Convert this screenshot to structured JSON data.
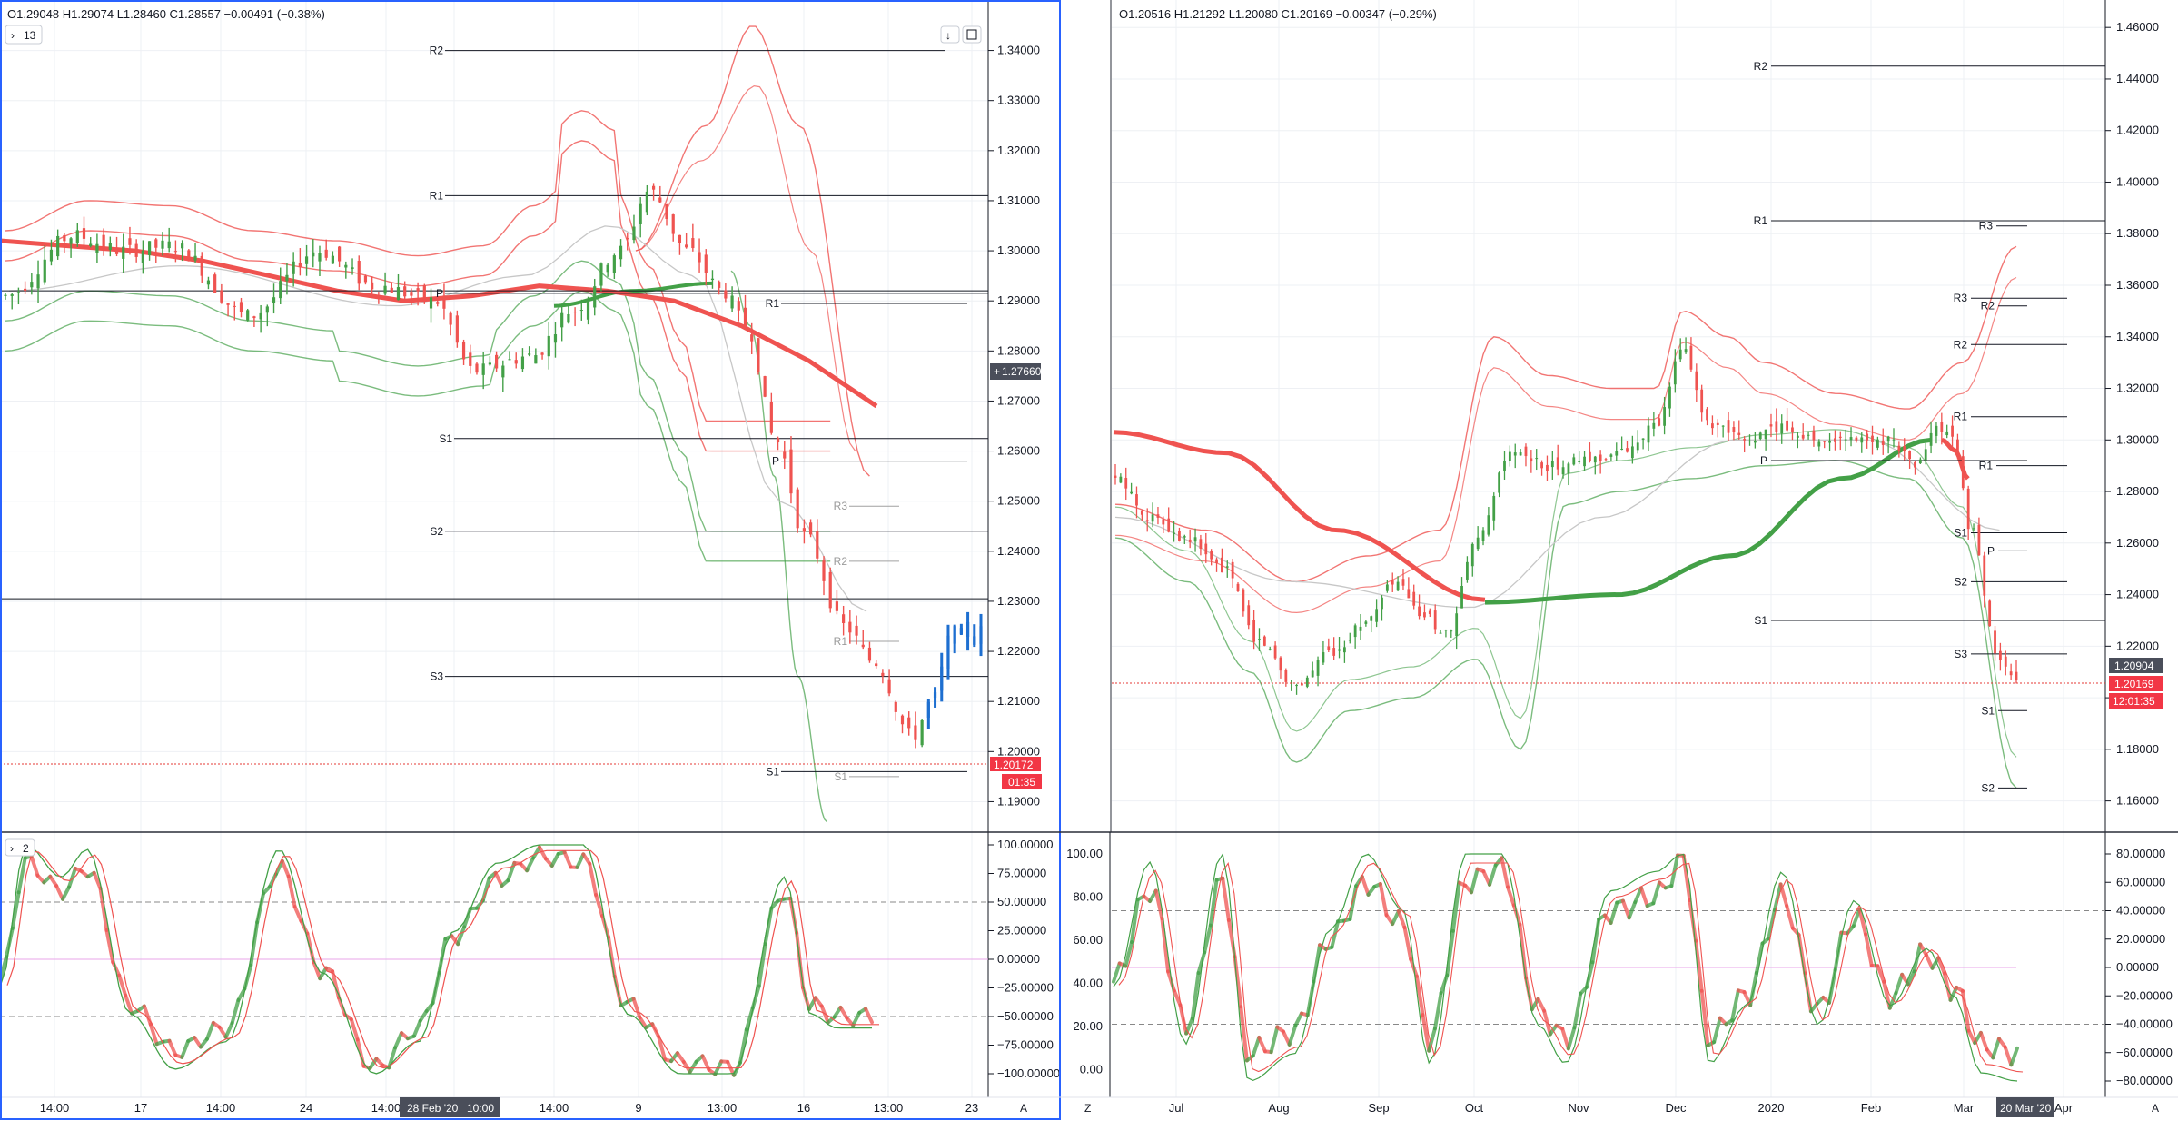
{
  "left_chart": {
    "ohlc": "O1.29048  H1.29074  L1.28460  C1.28557  −0.00491 (−0.38%)",
    "indicator_toggle": "13",
    "osc_toggle": "2",
    "price_ticks": [
      "1.34000",
      "1.33000",
      "1.32000",
      "1.31000",
      "1.30000",
      "1.29000",
      "1.28000",
      "1.27000",
      "1.26000",
      "1.25000",
      "1.24000",
      "1.23000",
      "1.22000",
      "1.21000",
      "1.20000",
      "1.19000"
    ],
    "osc_ticks": [
      "100.00000",
      "75.00000",
      "50.00000",
      "25.00000",
      "0.00000",
      "−25.00000",
      "−50.00000",
      "−75.00000",
      "−100.00000"
    ],
    "time_ticks": [
      "14:00",
      "17",
      "14:00",
      "24",
      "14:00",
      "14:00",
      "9",
      "13:00",
      "16",
      "13:00",
      "23"
    ],
    "crosshair_time": "28 Feb '20",
    "crosshair_time2": "10:00",
    "crosshair_price": "1.27660",
    "last_price": "1.20172",
    "countdown": "01:35",
    "pivots": [
      "R2",
      "R1",
      "P",
      "R1",
      "S1",
      "P",
      "S2",
      "S3",
      "S1",
      "R3",
      "R2",
      "R1",
      "S1"
    ],
    "axis_corner": "A"
  },
  "right_chart": {
    "ohlc": "O1.20516  H1.21292  L1.20080  C1.20169  −0.00347 (−0.29%)",
    "price_ticks": [
      "1.46000",
      "1.44000",
      "1.42000",
      "1.40000",
      "1.38000",
      "1.36000",
      "1.34000",
      "1.32000",
      "1.30000",
      "1.28000",
      "1.26000",
      "1.24000",
      "1.22000",
      "1.20000",
      "1.18000",
      "1.16000"
    ],
    "osc_left_ticks": [
      "100.00",
      "80.00",
      "60.00",
      "40.00",
      "20.00",
      "0.00"
    ],
    "osc_right_ticks": [
      "80.00000",
      "60.00000",
      "40.00000",
      "20.00000",
      "0.00000",
      "−20.00000",
      "−40.00000",
      "−60.00000",
      "−80.00000"
    ],
    "time_ticks": [
      "Jul",
      "Aug",
      "Sep",
      "Oct",
      "Nov",
      "Dec",
      "2020",
      "Feb",
      "Mar",
      "Apr"
    ],
    "crosshair_time": "20 Mar '20",
    "price_tag": "1.20904",
    "last_price": "1.20169",
    "countdown": "12:01:35",
    "pivots": [
      "R2",
      "R1",
      "R3",
      "R3",
      "R2",
      "R2",
      "R1",
      "P",
      "R1",
      "S1",
      "P",
      "S2",
      "S1",
      "S3",
      "S1",
      "S2"
    ],
    "axis_corner_left": "Z",
    "axis_corner": "A"
  },
  "colors": {
    "red": "#ef5350",
    "green": "#43a047",
    "blue": "#1e6fd0",
    "grid": "#eef0f4",
    "axis": "#131722"
  },
  "chart_data": [
    {
      "type": "candlestick",
      "title": "",
      "ylim": [
        1.185,
        1.345
      ],
      "open": 1.29048,
      "high": 1.29074,
      "low": 1.2846,
      "close": 1.28557,
      "change": -0.00491,
      "change_pct": -0.38,
      "x_labels": [
        "14:00",
        "17",
        "14:00",
        "24",
        "14:00",
        "28 Feb '20",
        "14:00",
        "9",
        "13:00",
        "16",
        "13:00",
        "23"
      ],
      "series": [
        {
          "name": "",
          "style": "candles",
          "values_approx": [
            1.291,
            1.296,
            1.303,
            1.302,
            1.299,
            1.29,
            1.286,
            1.293,
            1.3,
            1.291,
            1.288,
            1.276,
            1.278,
            1.285,
            1.299,
            1.311,
            1.3,
            1.288,
            1.27,
            1.25,
            1.232,
            1.222,
            1.208,
            1.203,
            1.212,
            1.222,
            1.224
          ]
        },
        {
          "name": "",
          "style": "line",
          "color": "red",
          "values_approx": [
            1.302,
            1.301,
            1.3,
            1.298,
            1.295,
            1.292,
            1.29,
            1.291,
            1.293,
            1.292,
            1.29,
            1.285,
            1.278,
            1.269
          ]
        }
      ],
      "pivot_levels": {
        "R2": 1.34,
        "R1": 1.311,
        "P": 1.2915,
        "S1": 1.2625,
        "S2": 1.244,
        "S3": 1.215
      }
    },
    {
      "type": "candlestick",
      "title": "",
      "ylim": [
        1.15,
        1.465
      ],
      "open": 1.20516,
      "high": 1.21292,
      "low": 1.2008,
      "close": 1.20169,
      "change": -0.00347,
      "change_pct": -0.29,
      "x_labels": [
        "Jul",
        "Aug",
        "Sep",
        "Oct",
        "Nov",
        "Dec",
        "2020",
        "Feb",
        "Mar",
        "20 Mar '20",
        "Apr"
      ],
      "series": [
        {
          "name": "",
          "style": "candles",
          "values_approx": [
            1.285,
            1.27,
            1.255,
            1.25,
            1.215,
            1.205,
            1.225,
            1.245,
            1.225,
            1.25,
            1.295,
            1.29,
            1.3,
            1.285,
            1.3,
            1.335,
            1.3,
            1.295,
            1.305,
            1.3,
            1.3,
            1.295,
            1.305,
            1.285,
            1.25,
            1.205
          ]
        },
        {
          "name": "",
          "style": "line",
          "color": "red",
          "values_approx": [
            1.303,
            1.295,
            1.285,
            1.27,
            1.255,
            1.24,
            1.235
          ]
        },
        {
          "name": "",
          "style": "line",
          "color": "green",
          "values_approx": [
            1.235,
            1.24,
            1.25,
            1.262,
            1.275,
            1.288,
            1.3,
            1.29
          ]
        }
      ],
      "pivot_levels": {
        "R2": 1.445,
        "R1": 1.385,
        "S1": 1.23,
        "S2": 1.165
      }
    }
  ]
}
